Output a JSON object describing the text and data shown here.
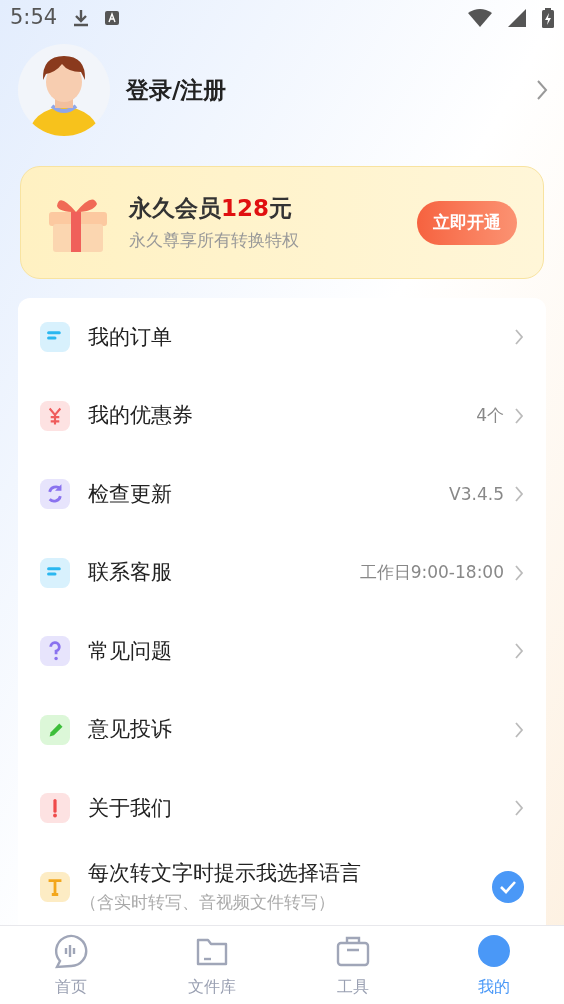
{
  "status_bar": {
    "time": "5:54"
  },
  "profile": {
    "login_label": "登录/注册"
  },
  "vip_card": {
    "title": "永久会员**128**元",
    "subtitle": "永久尊享所有转换特权",
    "button": "立即开通"
  },
  "menu": [
    {
      "kind": "link",
      "label": "我的订单"
    },
    {
      "kind": "link",
      "label": "我的优惠券",
      "value": "4个"
    },
    {
      "kind": "link",
      "label": "检查更新",
      "value": "V3.4.5"
    },
    {
      "kind": "link",
      "label": "联系客服",
      "value": "工作日9:00-18:00"
    },
    {
      "kind": "link",
      "label": "常见问题"
    },
    {
      "kind": "link",
      "label": "意见投诉"
    },
    {
      "kind": "link",
      "label": "关于我们"
    },
    {
      "kind": "toggle",
      "label": "每次转文字时提示我选择语言",
      "note": "（含实时转写、音视频文件转写）",
      "checked": true
    }
  ],
  "tab_bar": [
    {
      "label": "首页",
      "selected": false
    },
    {
      "label": "文件库",
      "selected": false
    },
    {
      "label": "工具",
      "selected": false
    },
    {
      "label": "我的",
      "selected": true
    }
  ]
}
